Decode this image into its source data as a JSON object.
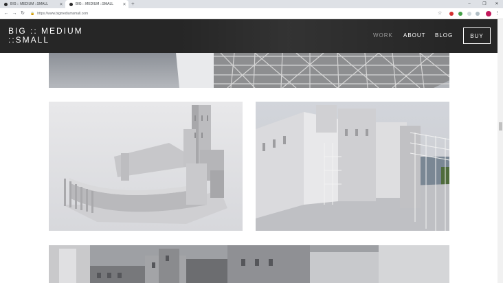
{
  "browser": {
    "tabs": [
      {
        "title": "BIG :: MEDIUM ::SMALL",
        "active": false
      },
      {
        "title": "BIG :: MEDIUM ::SMALL",
        "active": true
      }
    ],
    "url": "https://www.bigmediumsmall.com",
    "new_tab_icon": "plus-icon",
    "window_controls": {
      "minimize": "–",
      "maximize": "❐",
      "close": "✕"
    }
  },
  "site": {
    "logo_line1": "BIG :: MEDIUM",
    "logo_line2": "::SMALL",
    "nav": [
      "WORK",
      "ABOUT",
      "BLOG"
    ],
    "buy_label": "BUY"
  },
  "images": [
    {
      "name": "tower-scaffold-image"
    },
    {
      "name": "castle-model-image"
    },
    {
      "name": "city-wall-model-image"
    },
    {
      "name": "fortress-buildings-image"
    }
  ],
  "colors": {
    "header_bg": "#262626",
    "nav_inactive": "#9a9a9a",
    "accent_white": "#ffffff"
  }
}
